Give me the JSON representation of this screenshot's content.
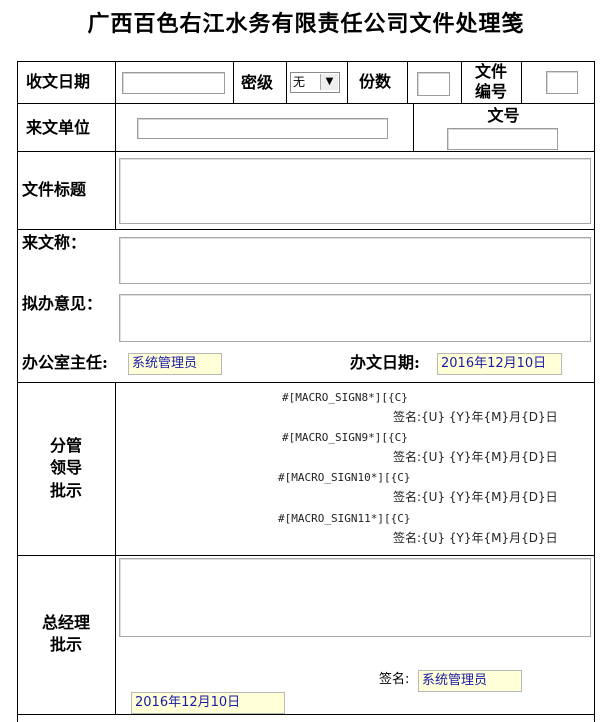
{
  "title": "广西百色右江水务有限责任公司文件处理笺",
  "fields": {
    "receive_date_label": "收文日期",
    "receive_date_value": "",
    "secret_level_label": "密级",
    "secret_level_value": "无",
    "copies_label": "份数",
    "copies_value": "",
    "file_number_label_1": "文件",
    "file_number_label_2": "编号",
    "file_number_value": "",
    "sender_unit_label": "来文单位",
    "sender_unit_value": "",
    "doc_number_label": "文号",
    "doc_number_value": "",
    "file_title_label": "文件标题",
    "file_title_value": ""
  },
  "middle": {
    "source_name_label": "来文称：",
    "draft_opinion_label": "拟办意见：",
    "office_director_label": "办公室主任:",
    "office_director_value": "系统管理员",
    "handle_date_label": "办文日期:",
    "handle_date_value": "2016年12月10日"
  },
  "leader": {
    "label_1": "分管",
    "label_2": "领导",
    "label_3": "批示",
    "entries": [
      {
        "macro": "#[MACRO_SIGN8*][{C}",
        "sign": "签名:{U}  {Y}年{M}月{D}日"
      },
      {
        "macro": "#[MACRO_SIGN9*][{C}",
        "sign": "签名:{U}  {Y}年{M}月{D}日"
      },
      {
        "macro": "#[MACRO_SIGN10*][{C}",
        "sign": "签名:{U}  {Y}年{M}月{D}日"
      },
      {
        "macro": "#[MACRO_SIGN11*][{C}",
        "sign": "签名:{U}  {Y}年{M}月{D}日"
      }
    ]
  },
  "gm": {
    "label_1": "总经理",
    "label_2": "批示",
    "sign_label": "签名:",
    "sign_value": "系统管理员",
    "date_value": "2016年12月10日"
  }
}
